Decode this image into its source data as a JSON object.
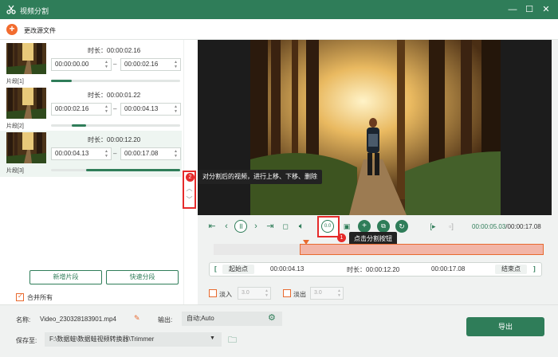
{
  "window": {
    "title": "视频分割",
    "minimize": "—",
    "maximize": "☐",
    "close": "✕"
  },
  "toolbar": {
    "add_icon": "+",
    "change_source": "更改源文件"
  },
  "segments": [
    {
      "name": "片段[1]",
      "duration": "时长：00:00:02.16",
      "start": "00:00:00.00",
      "end": "00:00:02.16",
      "progress_start": 0.0,
      "progress_end": 0.16
    },
    {
      "name": "片段[2]",
      "duration": "时长：00:00:01.22",
      "start": "00:00:02.16",
      "end": "00:00:04.13",
      "progress_start": 0.16,
      "progress_end": 0.27
    },
    {
      "name": "片段[3]",
      "duration": "时长：00:00:12.20",
      "start": "00:00:04.13",
      "end": "00:00:17.08",
      "progress_start": 0.27,
      "progress_end": 1.0
    }
  ],
  "segment_controls": {
    "close": "✕",
    "up": "︿",
    "down": "﹀"
  },
  "left_actions": {
    "add_segment": "新增片段",
    "quick_split": "快速分段",
    "merge_all": "合并所有"
  },
  "tooltips": {
    "move_hint": "对分割后的视频，进行上移、下移、删除",
    "split_hint": "点击分割按钮",
    "badge_1": "1",
    "badge_2": "2"
  },
  "playback": {
    "current": "00:00:05.03",
    "total": "/00:00:17.08",
    "cut_label": "0.0"
  },
  "timeline": {
    "selection_start": 0.26,
    "selection_end": 1.0,
    "playhead": 0.28
  },
  "range": {
    "open_bracket": "[",
    "start_label": "起始点",
    "start": "00:00:04.13",
    "duration": "时长：00:00:12.20",
    "end": "00:00:17.08",
    "end_label": "结束点",
    "close_bracket": "]"
  },
  "fade": {
    "fade_in": "淡入",
    "fade_in_value": "3.0",
    "fade_out": "淡出",
    "fade_out_value": "3.0"
  },
  "bottom": {
    "name_label": "名称:",
    "file_name": "Video_230328183901.mp4",
    "output_label": "输出:",
    "output_value": "自动;Auto",
    "save_label": "保存至:",
    "save_path": "F:\\数据蛙\\数据蛙视频转换器\\Trimmer",
    "export": "导出"
  },
  "colors": {
    "brand": "#2f7d59",
    "accent": "#e86a2f",
    "highlight": "#e52b2b"
  }
}
